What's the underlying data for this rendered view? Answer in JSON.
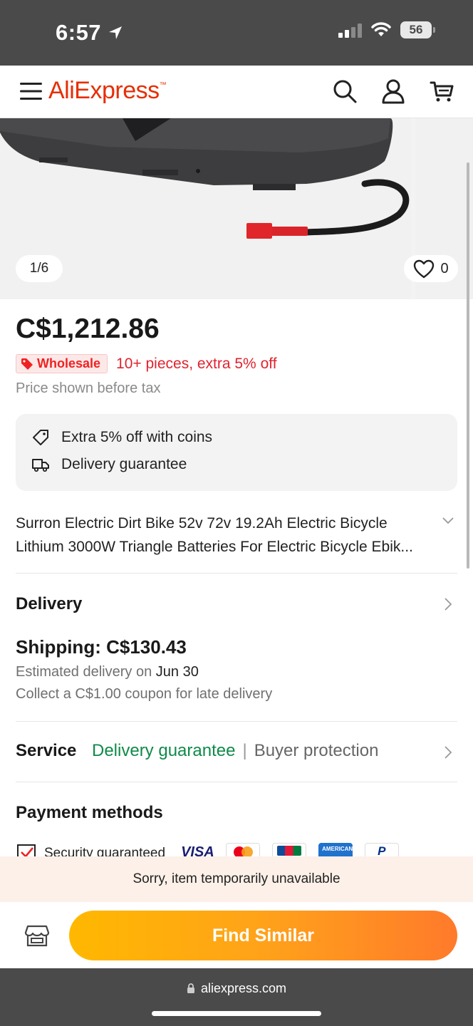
{
  "status_bar": {
    "time": "6:57",
    "battery": "56"
  },
  "header": {
    "logo": "AliExpress"
  },
  "gallery": {
    "counter": "1/6",
    "wishlist_count": "0"
  },
  "product": {
    "price": "C$1,212.86",
    "wholesale_badge": "Wholesale",
    "wholesale_text": "10+ pieces, extra 5% off",
    "tax_note": "Price shown before tax",
    "perks": [
      "Extra 5% off with coins",
      "Delivery guarantee"
    ],
    "title_line1": "Surron Electric Dirt Bike 52v 72v 19.2Ah Electric Bicycle",
    "title_line2": "Lithium 3000W Triangle Batteries For Electric Bicycle Ebik..."
  },
  "delivery": {
    "section_title": "Delivery",
    "shipping": "Shipping: C$130.43",
    "estimated_prefix": "Estimated delivery on ",
    "estimated_date": "Jun 30",
    "coupon": "Collect a C$1.00 coupon for late delivery"
  },
  "service": {
    "label": "Service",
    "guarantee": "Delivery guarantee",
    "separator": "|",
    "protection": "Buyer protection"
  },
  "payment": {
    "section_title": "Payment methods",
    "security": "Security guaranteed",
    "logos": [
      "visa-logo",
      "mastercard-logo",
      "jcb-logo",
      "amex-logo",
      "paypal-logo"
    ]
  },
  "banner": {
    "unavailable": "Sorry, item temporarily unavailable"
  },
  "actions": {
    "find_similar": "Find Similar"
  },
  "browser": {
    "url": "aliexpress.com"
  },
  "colors": {
    "brand": "#e62e04",
    "green": "#0f8a4a",
    "cta_start": "#ffb800",
    "cta_end": "#ff7a2b"
  }
}
